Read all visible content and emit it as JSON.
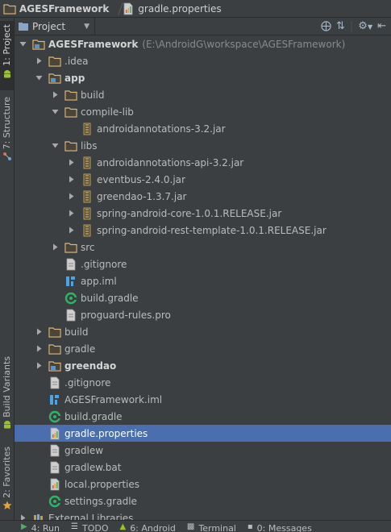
{
  "breadcrumbs": [
    {
      "label": "AGESFramework",
      "icon": "folder-icon",
      "bold": true
    },
    {
      "label": "gradle.properties",
      "icon": "properties-file-icon",
      "bold": false
    }
  ],
  "left_tabs": [
    {
      "label": "1: Project",
      "active": true
    },
    {
      "label": "7: Structure",
      "active": false
    },
    {
      "label": "Build Variants",
      "active": false
    },
    {
      "label": "2: Favorites",
      "active": false
    }
  ],
  "panel": {
    "view_label": "Project",
    "tools": [
      "sync-icon",
      "collapse-all-icon",
      "settings-gear-icon",
      "hide-panel-icon"
    ]
  },
  "tree": [
    {
      "level": 0,
      "arrow": "down",
      "icon": "module",
      "label": "AGESFramework",
      "extra": "(E:\\AndroidG\\workspace\\AGESFramework)",
      "bold": true
    },
    {
      "level": 1,
      "arrow": "right",
      "icon": "folder",
      "label": ".idea"
    },
    {
      "level": 1,
      "arrow": "down",
      "icon": "module",
      "label": "app",
      "bold": true
    },
    {
      "level": 2,
      "arrow": "right",
      "icon": "folder",
      "label": "build"
    },
    {
      "level": 2,
      "arrow": "down",
      "icon": "folder",
      "label": "compile-lib"
    },
    {
      "level": 3,
      "arrow": "none",
      "icon": "jar",
      "label": "androidannotations-3.2.jar"
    },
    {
      "level": 2,
      "arrow": "down",
      "icon": "folder",
      "label": "libs"
    },
    {
      "level": 3,
      "arrow": "right",
      "icon": "jar",
      "label": "androidannotations-api-3.2.jar"
    },
    {
      "level": 3,
      "arrow": "right",
      "icon": "jar",
      "label": "eventbus-2.4.0.jar"
    },
    {
      "level": 3,
      "arrow": "right",
      "icon": "jar",
      "label": "greendao-1.3.7.jar"
    },
    {
      "level": 3,
      "arrow": "right",
      "icon": "jar",
      "label": "spring-android-core-1.0.1.RELEASE.jar"
    },
    {
      "level": 3,
      "arrow": "right",
      "icon": "jar",
      "label": "spring-android-rest-template-1.0.1.RELEASE.jar"
    },
    {
      "level": 2,
      "arrow": "right",
      "icon": "folder",
      "label": "src"
    },
    {
      "level": 2,
      "arrow": "none",
      "icon": "text",
      "label": ".gitignore"
    },
    {
      "level": 2,
      "arrow": "none",
      "icon": "iml",
      "label": "app.iml"
    },
    {
      "level": 2,
      "arrow": "none",
      "icon": "gradle",
      "label": "build.gradle"
    },
    {
      "level": 2,
      "arrow": "none",
      "icon": "text",
      "label": "proguard-rules.pro"
    },
    {
      "level": 1,
      "arrow": "right",
      "icon": "folder",
      "label": "build"
    },
    {
      "level": 1,
      "arrow": "right",
      "icon": "folder",
      "label": "gradle"
    },
    {
      "level": 1,
      "arrow": "right",
      "icon": "module",
      "label": "greendao",
      "bold": true
    },
    {
      "level": 1,
      "arrow": "none",
      "icon": "text",
      "label": ".gitignore"
    },
    {
      "level": 1,
      "arrow": "none",
      "icon": "iml",
      "label": "AGESFramework.iml"
    },
    {
      "level": 1,
      "arrow": "none",
      "icon": "gradle",
      "label": "build.gradle"
    },
    {
      "level": 1,
      "arrow": "none",
      "icon": "properties",
      "label": "gradle.properties",
      "selected": true
    },
    {
      "level": 1,
      "arrow": "none",
      "icon": "text",
      "label": "gradlew"
    },
    {
      "level": 1,
      "arrow": "none",
      "icon": "text",
      "label": "gradlew.bat"
    },
    {
      "level": 1,
      "arrow": "none",
      "icon": "properties",
      "label": "local.properties"
    },
    {
      "level": 1,
      "arrow": "none",
      "icon": "gradle",
      "label": "settings.gradle"
    },
    {
      "level": 0,
      "arrow": "right",
      "icon": "libraries",
      "label": "External Libraries"
    }
  ],
  "bottom_tabs": [
    {
      "label": "4: Run",
      "icon": "run-icon"
    },
    {
      "label": "TODO",
      "icon": "todo-icon"
    },
    {
      "label": "6: Android",
      "icon": "android-icon"
    },
    {
      "label": "Terminal",
      "icon": "terminal-icon"
    },
    {
      "label": "0: Messages",
      "icon": "messages-icon"
    }
  ],
  "colors": {
    "background": "#3c3f41",
    "selection": "#4b6eaf",
    "folder": "#dcb67a",
    "gradle_green": "#2fb368",
    "text": "#bbbbbb"
  }
}
